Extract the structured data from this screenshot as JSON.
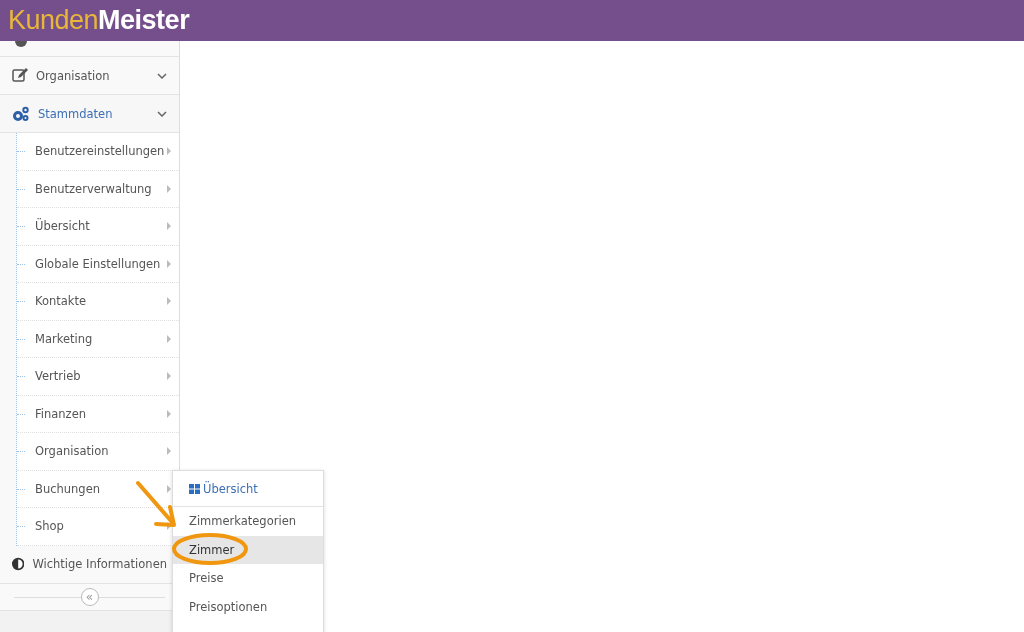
{
  "header": {
    "logo_part_1": "Kunden",
    "logo_part_2": "Meister"
  },
  "sidebar": {
    "items": [
      {
        "label": "Organisation",
        "kind": "edit",
        "expanded": false
      },
      {
        "label": "Stammdaten",
        "kind": "gears",
        "expanded": true,
        "children": [
          {
            "label": "Benutzereinstellungen"
          },
          {
            "label": "Benutzerverwaltung"
          },
          {
            "label": "Übersicht"
          },
          {
            "label": "Globale Einstellungen"
          },
          {
            "label": "Kontakte"
          },
          {
            "label": "Marketing"
          },
          {
            "label": "Vertrieb"
          },
          {
            "label": "Finanzen"
          },
          {
            "label": "Organisation"
          },
          {
            "label": "Buchungen"
          },
          {
            "label": "Shop"
          }
        ]
      },
      {
        "label": "Wichtige Informationen",
        "kind": "contrast"
      }
    ],
    "collapse_button": "«"
  },
  "flyout_menu": {
    "header": "Übersicht",
    "items": [
      {
        "label": "Zimmerkategorien",
        "selected": false
      },
      {
        "label": "Zimmer",
        "selected": true
      },
      {
        "label": "Preise",
        "selected": false
      },
      {
        "label": "Preisoptionen",
        "selected": false
      }
    ]
  }
}
